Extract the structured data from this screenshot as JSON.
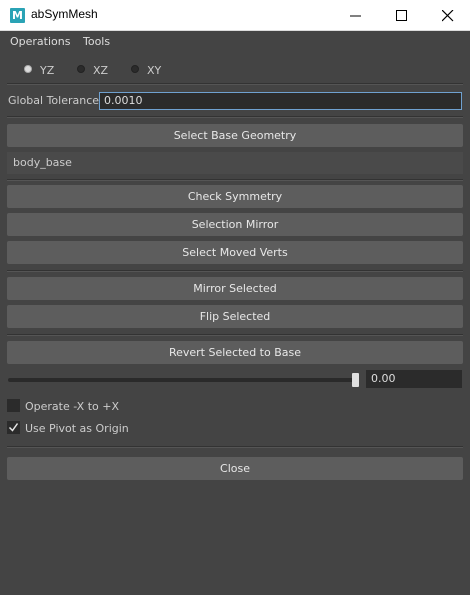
{
  "window": {
    "title": "abSymMesh",
    "app_icon_letter": "M"
  },
  "menu": [
    "Operations",
    "Tools"
  ],
  "axis_options": [
    {
      "label": "YZ",
      "selected": true
    },
    {
      "label": "XZ",
      "selected": false
    },
    {
      "label": "XY",
      "selected": false
    }
  ],
  "tolerance": {
    "label": "Global Tolerance",
    "value": "0.0010"
  },
  "buttons": {
    "select_base": "Select Base Geometry",
    "check_symmetry": "Check Symmetry",
    "selection_mirror": "Selection Mirror",
    "select_moved": "Select Moved Verts",
    "mirror_selected": "Mirror Selected",
    "flip_selected": "Flip Selected",
    "revert_selected": "Revert Selected to Base",
    "close": "Close"
  },
  "base_geometry": "body_base",
  "slider": {
    "value": "0.00",
    "fraction": 1.0
  },
  "options": [
    {
      "label": "Operate -X to +X",
      "checked": false
    },
    {
      "label": "Use Pivot as Origin",
      "checked": true
    }
  ]
}
